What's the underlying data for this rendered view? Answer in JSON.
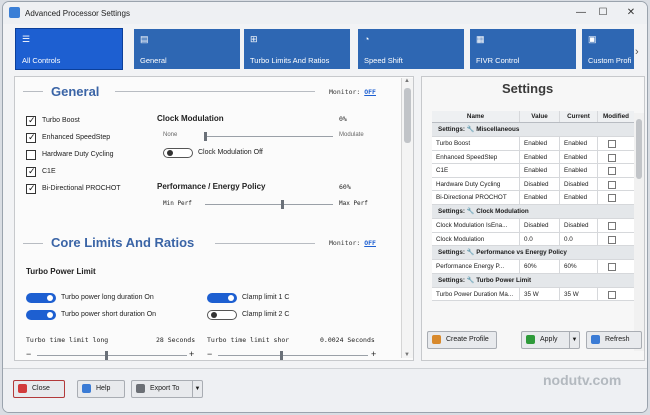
{
  "window": {
    "title": "Advanced Processor Settings"
  },
  "tabs": [
    {
      "label": "All Controls",
      "icon": "list-icon"
    },
    {
      "label": "General",
      "icon": "page-icon"
    },
    {
      "label": "Turbo Limits And Ratios",
      "icon": "chip-icon"
    },
    {
      "label": "Speed Shift",
      "icon": "gauge-icon"
    },
    {
      "label": "FIVR Control",
      "icon": "voltage-icon"
    },
    {
      "label": "Custom Profi",
      "icon": "profile-icon"
    }
  ],
  "general": {
    "heading": "General",
    "monitor_label": "Monitor:",
    "monitor_value": "OFF",
    "checkboxes": [
      {
        "label": "Turbo Boost",
        "checked": true
      },
      {
        "label": "Enhanced SpeedStep",
        "checked": true
      },
      {
        "label": "Hardware Duty Cycling",
        "checked": false
      },
      {
        "label": "C1E",
        "checked": true
      },
      {
        "label": "Bi-Directional PROCHOT",
        "checked": true
      }
    ],
    "clock_modulation": {
      "label": "Clock Modulation",
      "value": "0%",
      "min_label": "None",
      "max_label": "Modulate",
      "toggle_label": "Clock Modulation Off",
      "toggle_on": false,
      "level": 0.0
    },
    "perf_energy": {
      "label": "Performance / Energy Policy",
      "value": "60%",
      "min_label": "Min Perf",
      "max_label": "Max Perf",
      "level": 0.6
    }
  },
  "core_limits": {
    "heading": "Core Limits And Ratios",
    "monitor_label": "Monitor:",
    "monitor_value": "OFF",
    "subheading": "Turbo Power Limit",
    "toggles": [
      {
        "label": "Turbo power long duration On",
        "on": true
      },
      {
        "label": "Clamp limit 1 C",
        "on": true
      },
      {
        "label": "Turbo power short duration On",
        "on": true
      },
      {
        "label": "Clamp limit 2 C",
        "on": false
      }
    ],
    "time_limit_long": {
      "label": "Turbo time limit long",
      "value": "28 Seconds",
      "minus": "−",
      "plus": "+"
    },
    "time_limit_short": {
      "label": "Turbo time limit shor",
      "value": "0.0024 Seconds",
      "minus": "−",
      "plus": "+"
    }
  },
  "settings": {
    "title": "Settings",
    "columns": [
      "Name",
      "Value",
      "Current",
      "Modified"
    ],
    "rows": [
      {
        "type": "cat",
        "name": "Settings: 🔧 Miscellaneous"
      },
      {
        "type": "row",
        "name": "Turbo Boost",
        "value": "Enabled",
        "current": "Enabled"
      },
      {
        "type": "row",
        "name": "Enhanced SpeedStep",
        "value": "Enabled",
        "current": "Enabled"
      },
      {
        "type": "row",
        "name": "C1E",
        "value": "Enabled",
        "current": "Enabled"
      },
      {
        "type": "row",
        "name": "Hardware Duty Cycling",
        "value": "Disabled",
        "current": "Disabled"
      },
      {
        "type": "row",
        "name": "Bi-Directional PROCHOT",
        "value": "Enabled",
        "current": "Enabled"
      },
      {
        "type": "cat",
        "name": "Settings: 🔧 Clock Modulation"
      },
      {
        "type": "row",
        "name": "Clock Modulation IsEna...",
        "value": "Disabled",
        "current": "Disabled"
      },
      {
        "type": "row",
        "name": "Clock Modulation",
        "value": "0.0",
        "current": "0.0"
      },
      {
        "type": "cat",
        "name": "Settings: 🔧 Performance vs Energy Policy"
      },
      {
        "type": "row",
        "name": "Performance Energy P...",
        "value": "60%",
        "current": "60%"
      },
      {
        "type": "cat",
        "name": "Settings: 🔧 Turbo Power Limit"
      },
      {
        "type": "row",
        "name": "Turbo Power Duration Ma...",
        "value": "35 W",
        "current": "35 W"
      }
    ]
  },
  "buttons": {
    "create_profile": "Create Profile",
    "apply": "Apply",
    "refresh": "Refresh",
    "close": "Close",
    "help": "Help",
    "export": "Export To"
  },
  "watermark": "nodutv.com"
}
